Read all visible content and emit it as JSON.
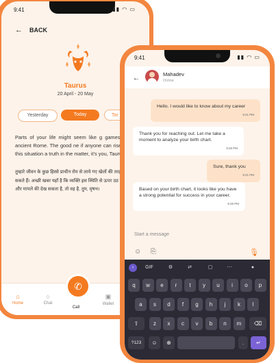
{
  "back_phone": {
    "status_time": "9:41",
    "back_label": "BACK",
    "sign_name": "Taurus",
    "sign_dates": "20 April - 20 May",
    "tabs": {
      "yesterday": "Yesterday",
      "today": "Today",
      "tomorrow": "Tor"
    },
    "horoscope_en": "Parts of your life might seem like g games out of ancient Rome. The good ne if anyone can rise above this situation a truth in the matter, it's you, Taurus.",
    "horoscope_hi": "तुम्हारे जीवन के कुछ हिस्से प्राचीन रोम से लाये गए खेलों की तरह लग सकते हैं। अच्छी खबर यहाँ है कि व्यक्ति इस स्थिति से ऊपर उठ सकता है और मामले की देख सकता है, तो वह है, तुम, वृषभ।",
    "nav": {
      "home": "Home",
      "chat": "Chat",
      "call": "Call",
      "wallet": "Wallet"
    }
  },
  "front_phone": {
    "status_time": "9:41",
    "contact": {
      "name": "Mahadev",
      "status": "Online"
    },
    "messages": [
      {
        "text": "Hello. I would like to know about my career",
        "time": "9:21 PM"
      },
      {
        "text": "Thank you for reaching out. Let me take a moment to analyze your birth chart.",
        "time": "9:28 PM"
      },
      {
        "text": "Sure, thank you",
        "time": "9:21 PM"
      },
      {
        "text": "Based on your birth chart, it looks like you have a strong potential for success in your career.",
        "time": "9:28 PM"
      }
    ],
    "input_placeholder": "Start a message",
    "keyboard": {
      "gif": "GIF",
      "row1": [
        "q",
        "w",
        "e",
        "r",
        "t",
        "y",
        "u",
        "i",
        "o",
        "p"
      ],
      "row2": [
        "a",
        "s",
        "d",
        "f",
        "g",
        "h",
        "j",
        "k",
        "l"
      ],
      "row3": [
        "z",
        "x",
        "c",
        "v",
        "b",
        "n",
        "m"
      ],
      "sym": "?123",
      "comma": ",",
      "period": "."
    }
  },
  "colors": {
    "accent": "#f47a20",
    "phone_frame": "#f3863f",
    "screen_bg": "#fdf3ea",
    "keyboard_bg": "#2b2a35",
    "sent_bubble": "#fde2c9"
  }
}
